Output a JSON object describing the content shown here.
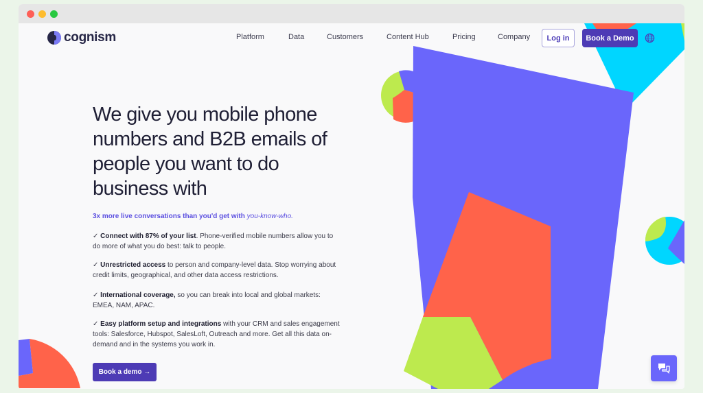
{
  "browser": {
    "controls": [
      "close",
      "minimize",
      "maximize"
    ]
  },
  "brand": {
    "name": "cognism",
    "colors": {
      "primary": "#4d3bb5",
      "accent_purple": "#6a66fb",
      "coral": "#ff634a",
      "lime": "#bdea4e",
      "cyan": "#00d6ff",
      "dark_text": "#1f1f35"
    }
  },
  "nav": {
    "links": [
      "Platform",
      "Data",
      "Customers",
      "Content Hub",
      "Pricing",
      "Company"
    ],
    "login_label": "Log in",
    "demo_label": "Book a Demo",
    "language_icon": "globe-icon"
  },
  "hero": {
    "title": "We give you mobile phone numbers and B2B emails of people you want to do business with",
    "tagline_main": "3x more live conversations than you'd get with ",
    "tagline_em": "you-know-who.",
    "bullets": [
      {
        "check": "✓ ",
        "bold": "Connect with 87% of your list",
        "text": ". Phone-verified mobile numbers allow you to do more of what you do best: talk to people."
      },
      {
        "check": "✓ ",
        "bold": "Unrestricted access",
        "text": " to person and company-level data. Stop worrying about credit limits, geographical, and other data access restrictions."
      },
      {
        "check": "✓ ",
        "bold": "International coverage,",
        "text": " so you can break into local and global markets: EMEA, NAM, APAC."
      },
      {
        "check": "✓ ",
        "bold": "Easy platform setup and integrations",
        "text": " with your CRM and sales engagement tools: Salesforce, Hubspot, SalesLoft, Outreach and more. Get all this data on-demand and in the systems you work in."
      }
    ],
    "cta_label": "Book a demo →"
  },
  "chat": {
    "icon": "chat-bubbles-icon"
  }
}
